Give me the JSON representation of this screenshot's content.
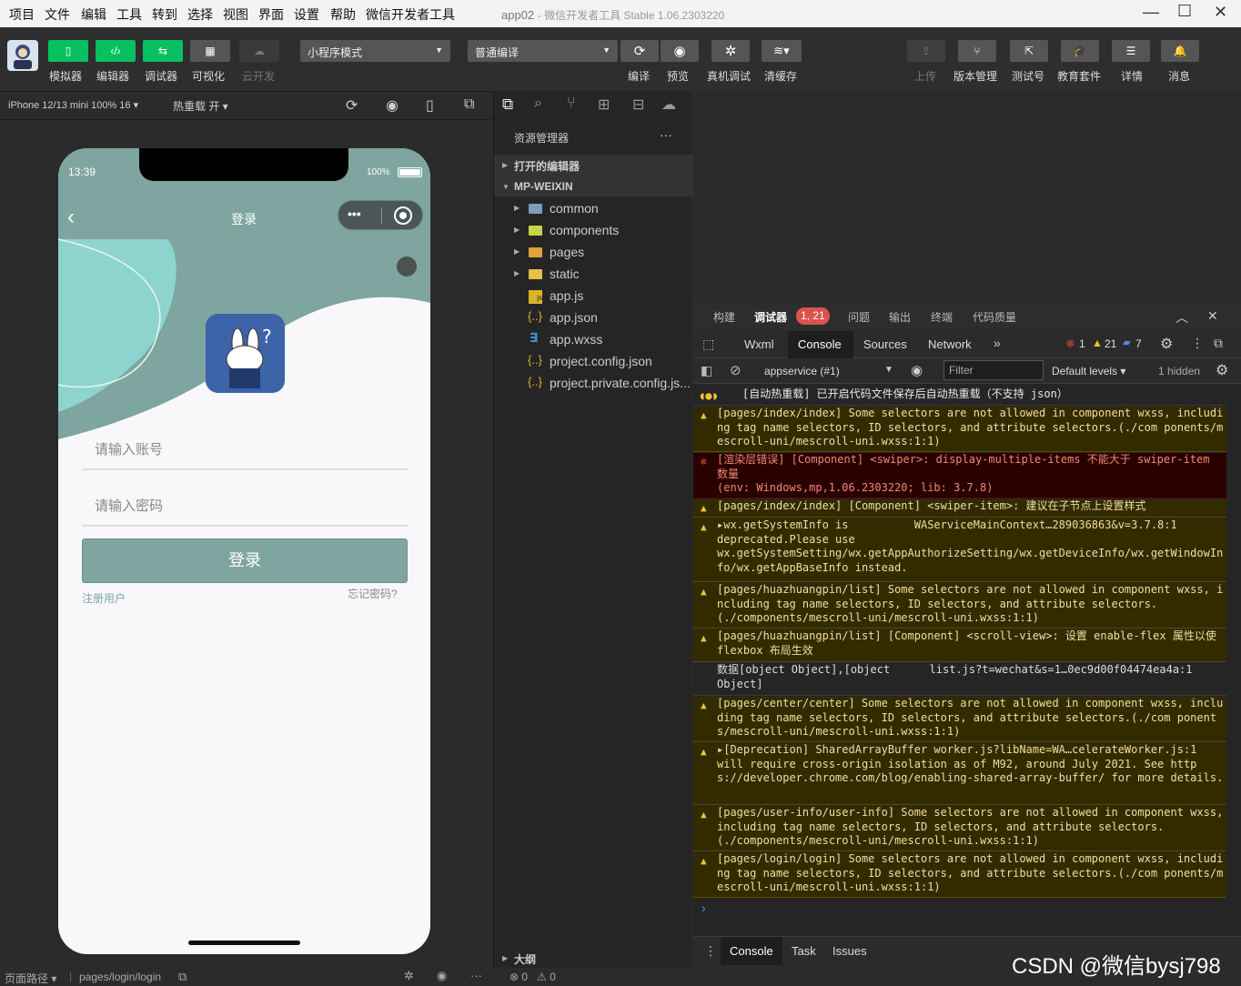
{
  "menu": [
    "项目",
    "文件",
    "编辑",
    "工具",
    "转到",
    "选择",
    "视图",
    "界面",
    "设置",
    "帮助",
    "微信开发者工具"
  ],
  "window_title": {
    "main": "app02",
    "sub": "- 微信开发者工具 Stable 1.06.2303220"
  },
  "toolbar": {
    "modes": [
      "模拟器",
      "编辑器",
      "调试器",
      "可视化",
      "云开发"
    ],
    "mode_select": "小程序模式",
    "compile_select": "普通编译",
    "actions": [
      "编译",
      "预览",
      "真机调试",
      "清缓存"
    ],
    "right_actions": [
      "上传",
      "版本管理",
      "测试号",
      "教育套件",
      "详情",
      "消息"
    ]
  },
  "simbar": {
    "device": "iPhone 12/13 mini 100% 16",
    "hotreload": "热重载 开"
  },
  "phone": {
    "time": "13:39",
    "battery": "100%",
    "nav_title": "登录",
    "account_placeholder": "请输入账号",
    "password_placeholder": "请输入密码",
    "login_button": "登录",
    "register": "注册用户",
    "forgot": "忘记密码?"
  },
  "explorer": {
    "title": "资源管理器",
    "open_editors": "打开的编辑器",
    "project": "MP-WEIXIN",
    "folders": [
      "common",
      "components",
      "pages",
      "static"
    ],
    "files": [
      "app.js",
      "app.json",
      "app.wxss",
      "project.config.json",
      "project.private.config.js..."
    ],
    "outline": "大纲"
  },
  "devtools": {
    "tabs": [
      "构建",
      "调试器",
      "问题",
      "输出",
      "终端",
      "代码质量"
    ],
    "badge": "1, 21",
    "subtabs": [
      "Wxml",
      "Console",
      "Sources",
      "Network"
    ],
    "counts": {
      "errors": "1",
      "warnings": "21",
      "info": "7"
    },
    "context": "appservice (#1)",
    "filter": "Filter",
    "levels": "Default levels",
    "hidden": "1 hidden",
    "logs": [
      {
        "type": "info",
        "text": "[自动热重载] 已开启代码文件保存后自动热重载（不支持 json）"
      },
      {
        "type": "warn",
        "text": "[pages/index/index] Some selectors are not allowed in component wxss, including tag name selectors, ID selectors, and attribute selectors.(./com ponents/mescroll-uni/mescroll-uni.wxss:1:1)"
      },
      {
        "type": "err",
        "text": "[渲染层错误] [Component] <swiper>: display-multiple-items 不能大于 swiper-item 数量\n(env: Windows,mp,1.06.2303220; lib: 3.7.8)"
      },
      {
        "type": "warn",
        "text": "[pages/index/index] [Component] <swiper-item>: 建议在子节点上设置样式"
      },
      {
        "type": "warn",
        "text": "▸wx.getSystemInfo is          WAServiceMainContext…289036863&v=3.7.8:1\ndeprecated.Please use\nwx.getSystemSetting/wx.getAppAuthorizeSetting/wx.getDeviceInfo/wx.getWindowInfo/wx.getAppBaseInfo instead."
      },
      {
        "type": "warn",
        "text": "[pages/huazhuangpin/list] Some selectors are not allowed in component wxss, including tag name selectors, ID selectors, and attribute selectors.\n(./components/mescroll-uni/mescroll-uni.wxss:1:1)"
      },
      {
        "type": "warn",
        "text": "[pages/huazhuangpin/list] [Component] <scroll-view>: 设置 enable-flex 属性以使 flexbox 布局生效"
      },
      {
        "type": "info",
        "text": "数据[object Object],[object      list.js?t=wechat&s=1…0ec9d00f04474ea4a:1\nObject]"
      },
      {
        "type": "warn",
        "text": "[pages/center/center] Some selectors are not allowed in component wxss, including tag name selectors, ID selectors, and attribute selectors.(./com ponents/mescroll-uni/mescroll-uni.wxss:1:1)"
      },
      {
        "type": "warn",
        "text": "▸[Deprecation] SharedArrayBuffer worker.js?libName=WA…celerateWorker.js:1\nwill require cross-origin isolation as of M92, around July 2021. See http s://developer.chrome.com/blog/enabling-shared-array-buffer/ for more details."
      },
      {
        "type": "warn",
        "text": "[pages/user-info/user-info] Some selectors are not allowed in component wxss, including tag name selectors, ID selectors, and attribute selectors.\n(./components/mescroll-uni/mescroll-uni.wxss:1:1)"
      },
      {
        "type": "warn",
        "text": "[pages/login/login] Some selectors are not allowed in component wxss, including tag name selectors, ID selectors, and attribute selectors.(./com ponents/mescroll-uni/mescroll-uni.wxss:1:1)"
      }
    ],
    "drawer_tabs": [
      "Console",
      "Task",
      "Issues"
    ]
  },
  "status": {
    "path_label": "页面路径",
    "path": "pages/login/login",
    "errors": "0",
    "warnings": "0"
  },
  "watermark": "CSDN @微信bysj798"
}
